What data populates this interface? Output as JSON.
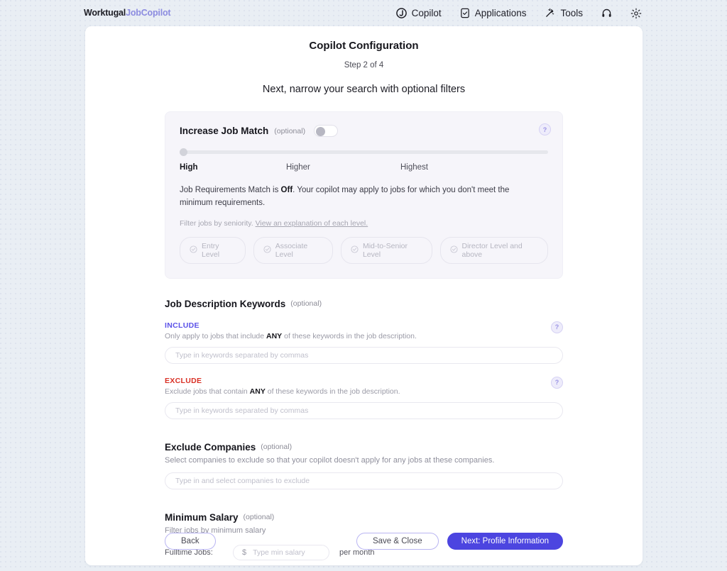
{
  "brand": {
    "name": "Worktugal",
    "product": "JobCopilot"
  },
  "nav": {
    "items": [
      {
        "label": "Copilot",
        "icon": "copilot-icon"
      },
      {
        "label": "Applications",
        "icon": "applications-icon"
      },
      {
        "label": "Tools",
        "icon": "tools-icon"
      }
    ],
    "support_icon": "headset-icon",
    "settings_icon": "gear-icon"
  },
  "header": {
    "title": "Copilot Configuration",
    "step": "Step 2 of 4",
    "subtitle": "Next, narrow your search with optional filters"
  },
  "job_match": {
    "title": "Increase Job Match",
    "optional": "(optional)",
    "toggle_state": "off",
    "help_icon": "?",
    "slider_value": 0,
    "scale": [
      "High",
      "Higher",
      "Highest"
    ],
    "description_prefix": "Job Requirements Match is ",
    "description_strong": "Off",
    "description_suffix": ". Your copilot may apply to jobs for which you don't meet the minimum requirements.",
    "seniority_note": "Filter jobs by seniority. ",
    "seniority_link": "View an explanation of each level.",
    "levels": [
      "Entry Level",
      "Associate Level",
      "Mid-to-Senior Level",
      "Director Level and above"
    ]
  },
  "keywords": {
    "title": "Job Description Keywords",
    "optional": "(optional)",
    "include": {
      "label": "INCLUDE",
      "hint_prefix": "Only apply to jobs that include ",
      "hint_strong": "ANY",
      "hint_suffix": " of these keywords in the job description.",
      "placeholder": "Type in keywords separated by commas",
      "value": "",
      "help_icon": "?"
    },
    "exclude": {
      "label": "EXCLUDE",
      "hint_prefix": "Exclude jobs that contain ",
      "hint_strong": "ANY",
      "hint_suffix": " of these keywords in the job description.",
      "placeholder": "Type in keywords separated by commas",
      "value": "",
      "help_icon": "?"
    }
  },
  "exclude_companies": {
    "title": "Exclude Companies",
    "optional": "(optional)",
    "hint": "Select companies to exclude so that your copilot doesn't apply for any jobs at these companies.",
    "placeholder": "Type in and select companies to exclude",
    "value": ""
  },
  "minimum_salary": {
    "title": "Minimum Salary",
    "optional": "(optional)",
    "hint": "Filter jobs by minimum salary",
    "row_label": "Fulltime Jobs:",
    "currency": "$",
    "placeholder": "Type min salary",
    "value": "",
    "period": "per month"
  },
  "footer": {
    "back": "Back",
    "save_close": "Save & Close",
    "next": "Next: Profile Information"
  },
  "colors": {
    "accent": "#4c45e0",
    "include": "#5b52e8",
    "exclude": "#d93025",
    "page_bg": "#e9eef4",
    "panel_bg": "#f6f5fa"
  }
}
